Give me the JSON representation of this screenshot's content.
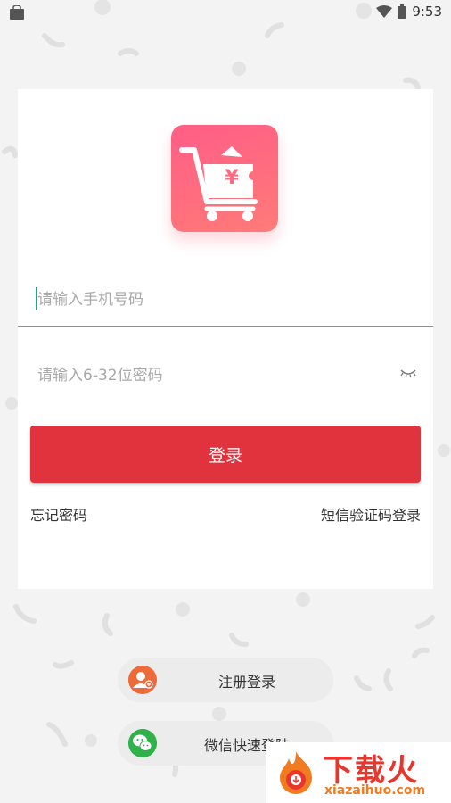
{
  "status_bar": {
    "time": "9:53"
  },
  "login": {
    "phone_placeholder": "请输入手机号码",
    "password_placeholder": "请输入6-32位密码",
    "login_button": "登录",
    "forgot_password": "忘记密码",
    "sms_login": "短信验证码登录"
  },
  "logo": {
    "currency_symbol": "¥"
  },
  "bottom_actions": {
    "register_label": "注册登录",
    "wechat_label": "微信快速登陆"
  },
  "watermark": {
    "title": "下载火",
    "site": "xiazaihuo.com"
  },
  "colors": {
    "accent_red": "#e0333d",
    "logo_pink": "#ff6b80",
    "wechat_green": "#2fb24a",
    "register_orange": "#ee6a3a"
  }
}
